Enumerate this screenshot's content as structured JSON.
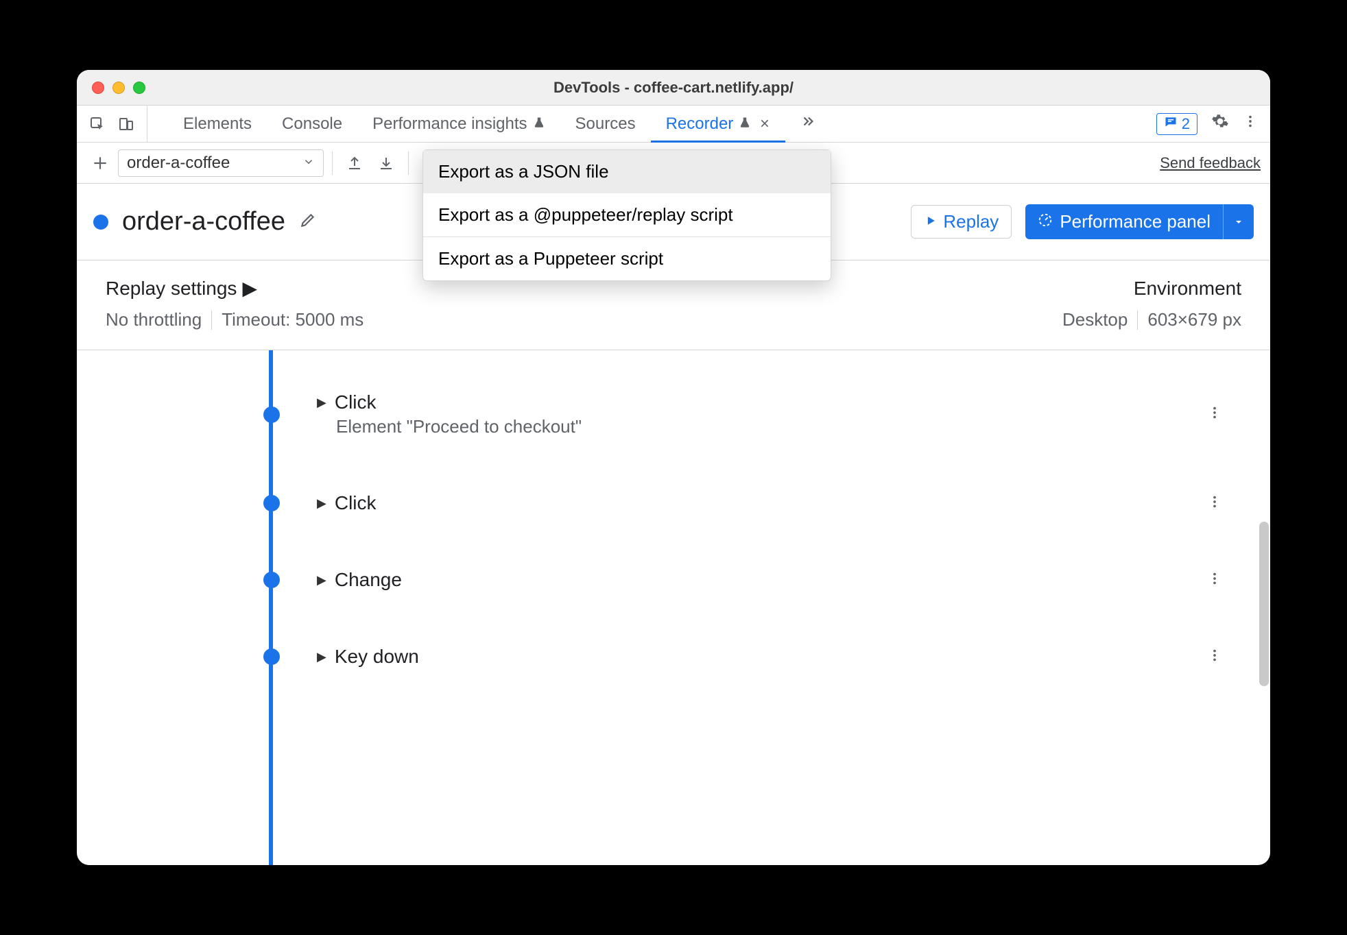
{
  "window": {
    "title": "DevTools - coffee-cart.netlify.app/"
  },
  "tabs": {
    "items": [
      "Elements",
      "Console",
      "Performance insights",
      "Sources",
      "Recorder"
    ],
    "active_index": 4,
    "issues_count": "2"
  },
  "toolbar": {
    "recording_name": "order-a-coffee",
    "send_feedback": "Send feedback"
  },
  "header": {
    "title": "order-a-coffee",
    "replay_label": "Replay",
    "perf_label": "Performance panel"
  },
  "export_menu": {
    "items": [
      "Export as a JSON file",
      "Export as a @puppeteer/replay script",
      "Export as a Puppeteer script"
    ],
    "hover_index": 0
  },
  "settings": {
    "replay_title": "Replay settings",
    "env_title": "Environment",
    "throttling": "No throttling",
    "timeout": "Timeout: 5000 ms",
    "device": "Desktop",
    "viewport": "603×679 px"
  },
  "steps": [
    {
      "label": "Click",
      "desc": "Element \"Proceed to checkout\""
    },
    {
      "label": "Click",
      "desc": ""
    },
    {
      "label": "Change",
      "desc": ""
    },
    {
      "label": "Key down",
      "desc": ""
    }
  ]
}
